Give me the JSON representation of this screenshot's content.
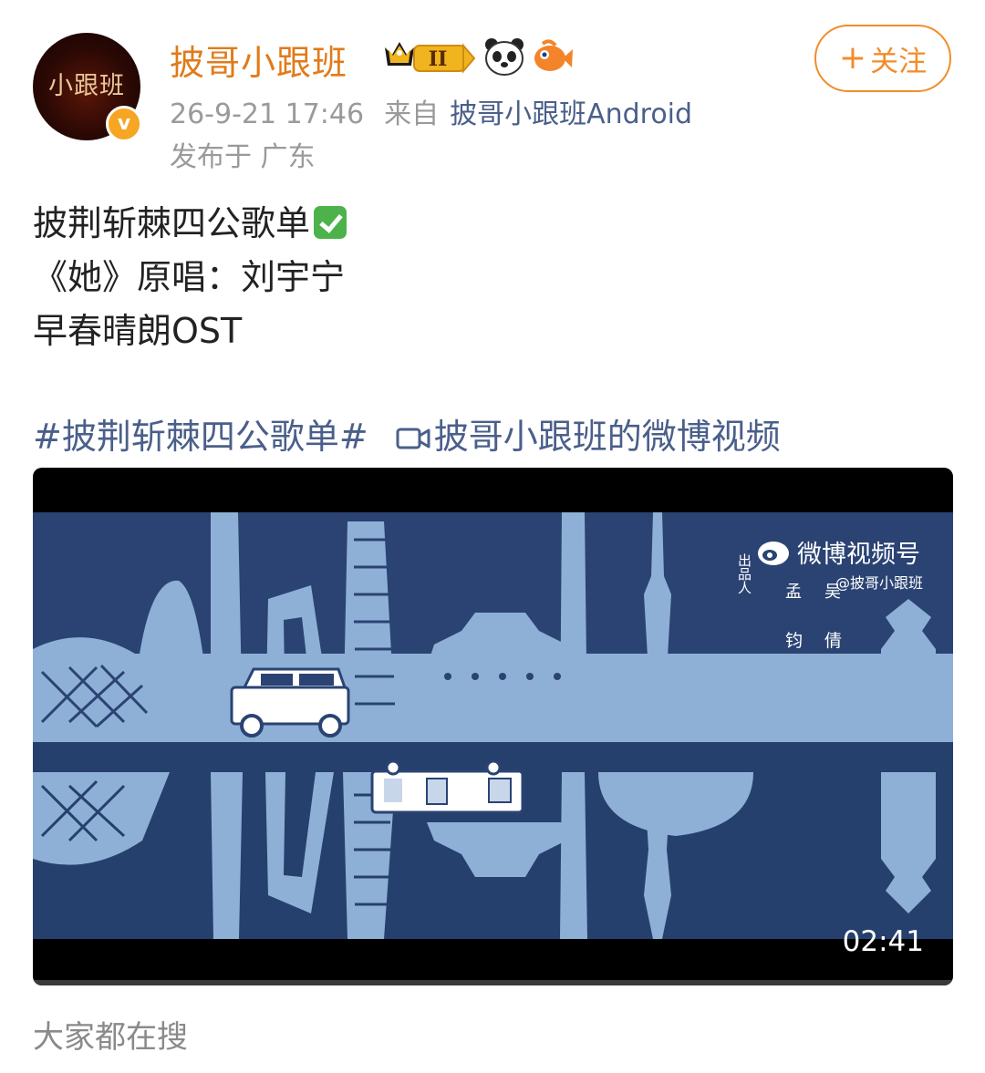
{
  "post": {
    "author": {
      "name": "披哥小跟班",
      "avatar_text": "小跟班",
      "verified_mark": "v",
      "level_badge": "II",
      "badges": [
        "crown-level-badge",
        "panda-badge",
        "fish-badge"
      ]
    },
    "follow_button": {
      "plus": "+",
      "label": "关注"
    },
    "timestamp": "26-9-21 17:46",
    "source_prefix": "来自",
    "source_app": "披哥小跟班Android",
    "location": "发布于 广东",
    "text_lines": [
      "披荆斩棘四公歌单",
      "《她》原唱：刘宇宁",
      "早春晴朗OST"
    ],
    "hashtag": "#披荆斩棘四公歌单#",
    "video_link": "披哥小跟班的微博视频",
    "video": {
      "watermark_brand": "微博视频号",
      "watermark_producer": "出品人",
      "watermark_names": [
        "孟",
        "吴",
        "钧",
        "倩"
      ],
      "watermark_handle": "@披哥小跟班",
      "duration": "02:41"
    },
    "trending_label": "大家都在搜"
  },
  "colors": {
    "username": "#e07b1a",
    "follow": "#f28c2a",
    "link": "#4a5f8a",
    "meta": "#9a9a9a",
    "sky": "#2a4373",
    "city": "#8fb0d6"
  }
}
